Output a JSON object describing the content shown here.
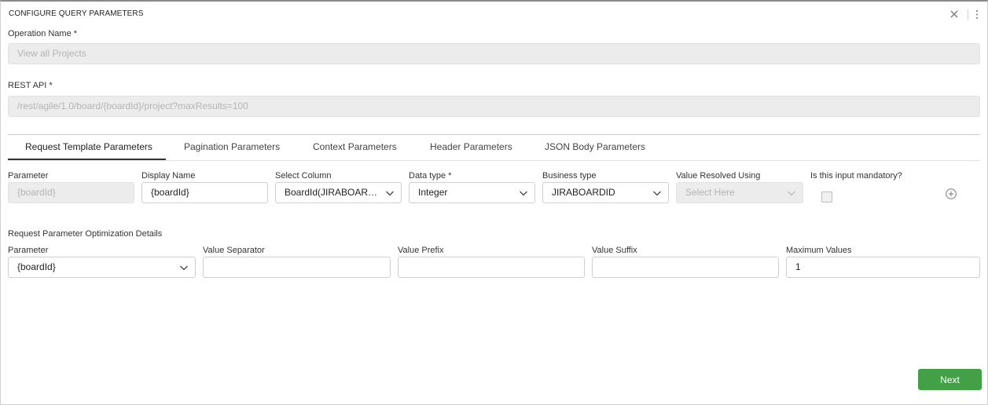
{
  "dialog": {
    "title": "CONFIGURE QUERY PARAMETERS"
  },
  "operation_name": {
    "label": "Operation Name *",
    "value": "View all Projects"
  },
  "rest_api": {
    "label": "REST API *",
    "value": "/rest/agile/1.0/board/{boardId}/project?maxResults=100"
  },
  "tabs": [
    {
      "label": "Request Template Parameters",
      "active": true
    },
    {
      "label": "Pagination Parameters",
      "active": false
    },
    {
      "label": "Context Parameters",
      "active": false
    },
    {
      "label": "Header Parameters",
      "active": false
    },
    {
      "label": "JSON Body Parameters",
      "active": false
    }
  ],
  "request_params": {
    "headers": {
      "parameter": "Parameter",
      "display_name": "Display Name",
      "select_column": "Select Column",
      "data_type": "Data type *",
      "business_type": "Business type",
      "value_resolved_using": "Value Resolved Using",
      "mandatory": "Is this input mandatory?"
    },
    "row": {
      "parameter": "{boardId}",
      "display_name": "{boardId}",
      "select_column": "BoardId(JIRABOARDID)",
      "data_type": "Integer",
      "business_type": "JIRABOARDID",
      "value_resolved_using_placeholder": "Select Here",
      "mandatory": false
    }
  },
  "optimization": {
    "title": "Request Parameter Optimization Details",
    "headers": {
      "parameter": "Parameter",
      "value_separator": "Value Separator",
      "value_prefix": "Value Prefix",
      "value_suffix": "Value Suffix",
      "maximum_values": "Maximum Values"
    },
    "row": {
      "parameter": "{boardId}",
      "value_separator": "",
      "value_prefix": "",
      "value_suffix": "",
      "maximum_values": "1"
    }
  },
  "footer": {
    "next_label": "Next"
  },
  "colors": {
    "primary_button": "#43a047",
    "active_tab_underline": "#333333",
    "disabled_field": "#ececec"
  },
  "icons": [
    "close-icon",
    "more-vertical-icon",
    "chevron-down-icon",
    "add-circle-icon"
  ]
}
